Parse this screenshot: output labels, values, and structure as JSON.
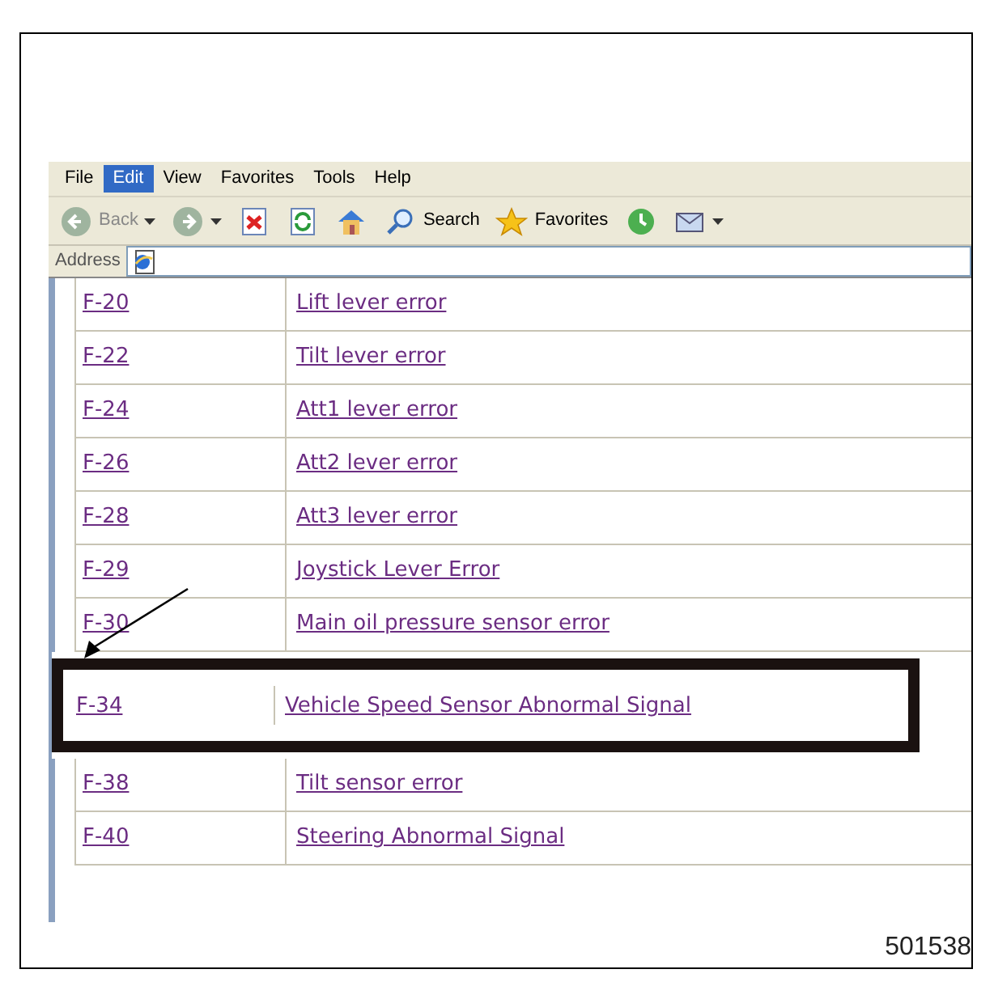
{
  "menu": [
    {
      "label": "File",
      "selected": false
    },
    {
      "label": "Edit",
      "selected": true
    },
    {
      "label": "View",
      "selected": false
    },
    {
      "label": "Favorites",
      "selected": false
    },
    {
      "label": "Tools",
      "selected": false
    },
    {
      "label": "Help",
      "selected": false
    }
  ],
  "toolbar": [
    {
      "kind": "back",
      "label": "Back",
      "disabled": true
    },
    {
      "kind": "forward"
    },
    {
      "kind": "stop"
    },
    {
      "kind": "refresh"
    },
    {
      "kind": "home"
    },
    {
      "kind": "search",
      "label": "Search"
    },
    {
      "kind": "favorites",
      "label": "Favorites"
    },
    {
      "kind": "history"
    },
    {
      "kind": "mail"
    }
  ],
  "address": {
    "label": "Address"
  },
  "rows": [
    {
      "kind": "row",
      "code": "F-20",
      "name": "Lift lever error"
    },
    {
      "kind": "row",
      "code": "F-22",
      "name": "Tilt lever error"
    },
    {
      "kind": "row",
      "code": "F-24",
      "name": "Att1 lever error"
    },
    {
      "kind": "row",
      "code": "F-26",
      "name": "Att2 lever error"
    },
    {
      "kind": "row",
      "code": "F-28",
      "name": "Att3 lever error"
    },
    {
      "kind": "row",
      "code": "F-29",
      "name": "Joystick Lever Error"
    },
    {
      "kind": "row",
      "code": "F-30",
      "name": "Main oil pressure sensor error"
    },
    {
      "kind": "callout",
      "code": "F-34",
      "name": "Vehicle Speed Sensor Abnormal Signal"
    },
    {
      "kind": "row",
      "code": "F-38",
      "name": "Tilt sensor error"
    },
    {
      "kind": "row",
      "code": "F-40",
      "name": "Steering Abnormal Signal"
    }
  ],
  "figure_number": "501538"
}
